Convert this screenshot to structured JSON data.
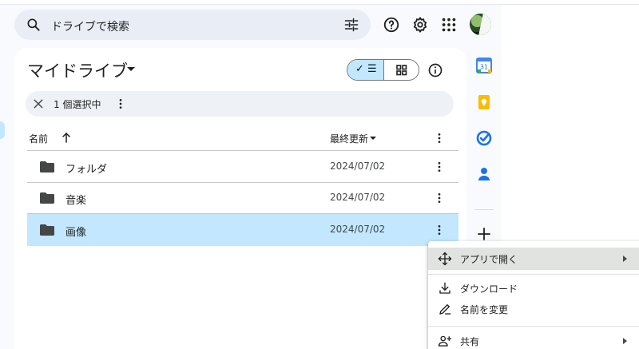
{
  "search": {
    "placeholder": "ドライブで検索"
  },
  "header": {
    "title": "マイドライブ"
  },
  "selection": {
    "count_label": "1 個選択中"
  },
  "columns": {
    "name": "名前",
    "modified": "最終更新"
  },
  "files": [
    {
      "name": "フォルダ",
      "date": "2024/07/02",
      "selected": false
    },
    {
      "name": "音楽",
      "date": "2024/07/02",
      "selected": false
    },
    {
      "name": "画像",
      "date": "2024/07/02",
      "selected": true
    }
  ],
  "side_panel": {
    "calendar_day": "31"
  },
  "context_menu": {
    "items": [
      {
        "label": "アプリで開く",
        "icon": "open-with-icon",
        "submenu": true,
        "highlighted": true
      },
      {
        "label": "ダウンロード",
        "icon": "download-icon",
        "submenu": false
      },
      {
        "label": "名前を変更",
        "icon": "rename-icon",
        "submenu": false
      },
      {
        "label": "共有",
        "icon": "share-icon",
        "submenu": true
      }
    ]
  },
  "colors": {
    "accent": "#0b57d0",
    "selected_bg": "#c2e7ff",
    "search_bg": "#e9eef6"
  }
}
